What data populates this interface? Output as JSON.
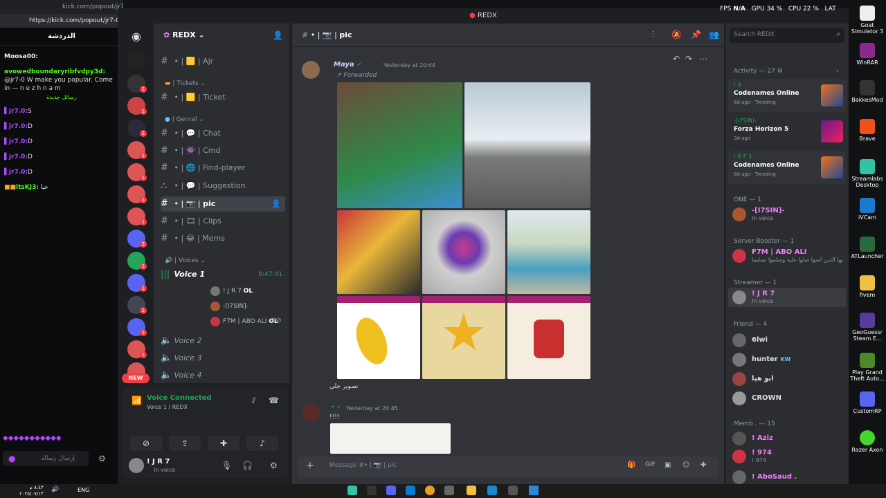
{
  "kick": {
    "browser_tab": "kick.com/popout/jr7-0/",
    "url": "https://kick.com/popout/jr7-0/",
    "chat_title": "الدردشة",
    "messages": [
      {
        "user": "Moosa00:",
        "text": ""
      },
      {
        "user": "avowedboundaryribfvdpy3d:",
        "text": "@jr7-0 W make you popular. Come in — n e z h n a m"
      },
      {
        "user": "jr7.0:",
        "text": "S"
      },
      {
        "user": "jr7.0:",
        "text": "D"
      },
      {
        "user": "jr7.0:",
        "text": "D"
      },
      {
        "user": "jr7.0:",
        "text": "D"
      },
      {
        "user": "jr7.0:",
        "text": "D"
      },
      {
        "user": "itsKJ3:",
        "text": "حيا"
      }
    ],
    "new_messages_divider": "رسائل جديدة",
    "input_placeholder": "إرسال رسالة"
  },
  "discord": {
    "window_title": "REDX",
    "server_name": "REDX",
    "channel_name": "pic",
    "search_placeholder": "Search REDX",
    "message_placeholder": "Message #• | 📷 | pic",
    "categories": [
      {
        "label": "| Tickets"
      },
      {
        "label": "| Genral"
      },
      {
        "label": "| Voices"
      }
    ],
    "channels": [
      {
        "label": "Ajr"
      },
      {
        "label": "Ticket"
      },
      {
        "label": "Chat"
      },
      {
        "label": "Cmd"
      },
      {
        "label": "Find-player"
      },
      {
        "label": "Suggestion"
      },
      {
        "label": "pic"
      },
      {
        "label": "Clips"
      },
      {
        "label": "Mems"
      }
    ],
    "voice_channels": [
      {
        "label": "Voice 1",
        "timer": "8:47:41"
      },
      {
        "label": "Voice 2"
      },
      {
        "label": "Voice 3"
      },
      {
        "label": "Voice 4"
      }
    ],
    "voice_users": [
      "! J R 7",
      "-[I7SIN]-",
      "F7M | ABO ALI"
    ],
    "voice_badge": "OL",
    "new_badge": "NEW",
    "voice_connected": {
      "status": "Voice Connected",
      "location": "Voice 1 / REDX"
    },
    "user": {
      "name": "! J R 7",
      "status": "In voice"
    },
    "messages": [
      {
        "author": "Maya",
        "time": "Yesterday at 20:44",
        "forwarded": "Forwarded",
        "caption": "تصوير جلي"
      },
      {
        "author": "",
        "time": "Yesterday at 20:45",
        "text": "!!!!"
      }
    ],
    "activity": {
      "title": "Activity — 27",
      "items": [
        {
          "user": "! A",
          "game": "Codenames Online",
          "meta": "6d ago",
          "tag": "Trending"
        },
        {
          "user": "-[I7SIN]-",
          "game": "Forza Horizon 5",
          "meta": "3d ago",
          "tag": ""
        },
        {
          "user": "! B F 3",
          "game": "Codenames Online",
          "meta": "8d ago",
          "tag": "Trending"
        }
      ]
    },
    "member_groups": [
      {
        "title": "ONE — 1",
        "members": [
          {
            "name": "-[I7SIN]-",
            "status": "In voice"
          }
        ]
      },
      {
        "title": "Server Booster — 1",
        "members": [
          {
            "name": "F7M | ABO ALI",
            "status": "الرد الأيها الذين آمنوا صلوا عليه وسلموا تسليما"
          }
        ]
      },
      {
        "title": "Streamer — 1",
        "members": [
          {
            "name": "! J R 7",
            "status": "In voice"
          }
        ]
      },
      {
        "title": "Friend — 4",
        "members": [
          {
            "name": "6lwi",
            "status": ""
          },
          {
            "name": "hunter",
            "status": "KW"
          },
          {
            "name": "ابو هيا",
            "status": ""
          },
          {
            "name": "CROWN",
            "status": ""
          }
        ]
      },
      {
        "title": "Memb . — 15",
        "members": [
          {
            "name": "! Aziz",
            "status": ""
          },
          {
            "name": "! 974",
            "status": "! 974"
          },
          {
            "name": "! AboSaud .",
            "status": ""
          }
        ]
      }
    ]
  },
  "overlay": {
    "fps_label": "FPS",
    "fps_value": "N/A",
    "gpu": "GPU 34 %",
    "cpu": "CPU 22 %",
    "lat": "LAT"
  },
  "desktop_icons": [
    {
      "label": "Goat Simulator 3"
    },
    {
      "label": "WinRAR"
    },
    {
      "label": "BakkesMod"
    },
    {
      "label": "Brave"
    },
    {
      "label": "Streamlabs Desktop"
    },
    {
      "label": "iVCam"
    },
    {
      "label": "ATLauncher"
    },
    {
      "label": "fivem"
    },
    {
      "label": "GeoGuessr Steam E..."
    },
    {
      "label": "Play Grand Theft Auto..."
    },
    {
      "label": "CustomRP"
    },
    {
      "label": "Razer Axon"
    }
  ],
  "taskbar": {
    "lang": "ENG",
    "date": "٢٠٢٥/٠٧/١٣",
    "time": "٨:٤٣ م"
  },
  "colors": {
    "accent": "#5865f2",
    "kick_green": "#53fc18",
    "danger": "#f23f43",
    "online": "#23a55a",
    "booster_pink": "#f47fff"
  }
}
